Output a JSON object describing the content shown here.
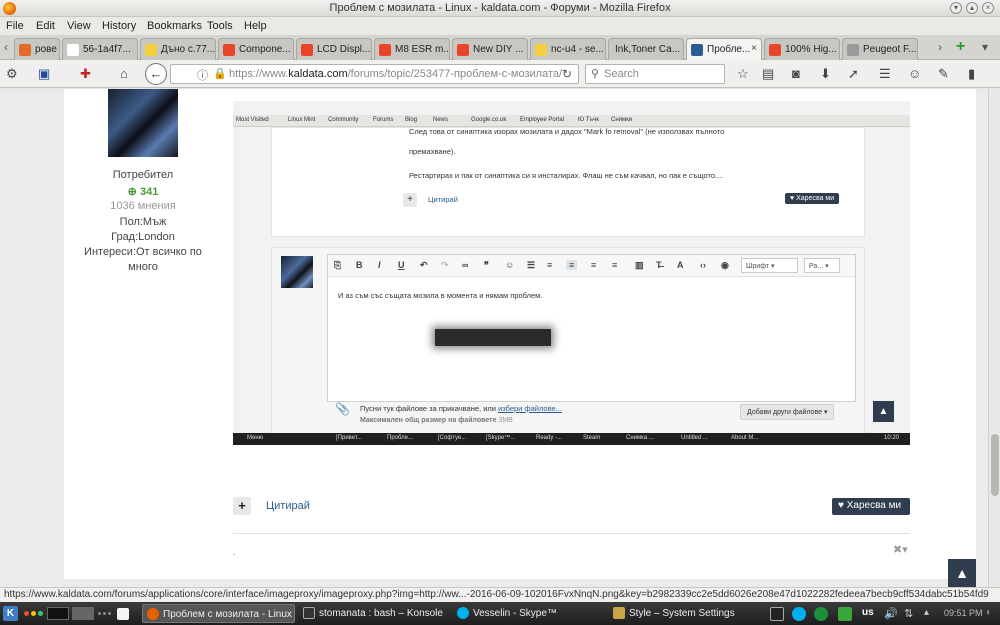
{
  "window": {
    "title": "Проблем с мозилата - Linux - kaldata.com - Форуми - Mozilla Firefox"
  },
  "menu": [
    "File",
    "Edit",
    "View",
    "History",
    "Bookmarks",
    "Tools",
    "Help"
  ],
  "tabs": [
    {
      "label": "рове и...",
      "color": "#e56b2c"
    },
    {
      "label": "56-1a4f7...",
      "color": "#ffffff"
    },
    {
      "label": "Дъно с.77...",
      "color": "#f4d03f"
    },
    {
      "label": "Compone...",
      "color": "#e8452c"
    },
    {
      "label": "LCD Displ...",
      "color": "#e8452c"
    },
    {
      "label": "M8 ESR m...",
      "color": "#e8452c"
    },
    {
      "label": "New DIY ...",
      "color": "#e8452c"
    },
    {
      "label": "nc-u4 - se...",
      "color": "#f4d03f"
    },
    {
      "label": "Ink,Toner Ca...",
      "color": "#d8d8d8"
    },
    {
      "label": "Пробле...",
      "color": "#2a5d8f",
      "active": true
    },
    {
      "label": "100% Hig...",
      "color": "#e8452c"
    },
    {
      "label": "Peugeot F...",
      "color": "#9a9a9a"
    }
  ],
  "nav": {
    "url_prefix": "https://www.",
    "url_domain": "kaldata.com",
    "url_path": "/forums/topic/253477-проблем-с-мозилата/",
    "search_placeholder": "Search"
  },
  "profile": {
    "role": "Потребител",
    "reputation": "341",
    "posts": "1036 мнения",
    "gender": "Пол:Мъж",
    "city": "Град:London",
    "interests_line1": "Интереси:От всичко по",
    "interests_line2": "много"
  },
  "shot": {
    "bookmarks": [
      "Most Visited",
      "Linux Mint",
      "Community",
      "Forums",
      "Blog",
      "News",
      "Google.co.uk",
      "Employee Portal",
      "Ю Тъчк",
      "Снимки"
    ],
    "line1": "След това от синаптика изорах мозилата и дадох \"Mark fo removal\" (не използвах пълното",
    "line2": "премахване).",
    "line3": "Рестартирах и пак от синаптика си я инсталирах. Флаш не съм качвал, но пак е същото....",
    "quote_link": "Цитирай",
    "like_label": "Харесва ми",
    "font_select": "Шрифт",
    "size_select": "Ра...",
    "editor_text": "И аз съм със същата мозила в момента и нямам проблем.",
    "attach_text": "Пусни тук файлове за прикачване, или",
    "attach_link": "избери файлове...",
    "attach_limit_label": "Максимален общ размер на файловете",
    "attach_limit_value": "3MB",
    "more_files": "Добави други файлове",
    "taskbar": [
      "Меню",
      "[Привет...",
      "Пробле...",
      "[Софтуе...",
      "[Skype™...",
      "Ready -...",
      "Steam",
      "Снимка ...",
      "Untitled ...",
      "About M..."
    ],
    "clock": "10:20"
  },
  "post_footer": {
    "quote_label": "Цитирай",
    "like_label": "Харесва ми",
    "dot": "."
  },
  "status_url": "https://www.kaldata.com/forums/applications/core/interface/imageproxy/imageproxy.php?img=http://ww...-2016-06-09-102016FvxNnqN.png&key=b2982339cc2e5dd6026e208e47d1022282fedeea7becb9cff534dabc51b54fd9",
  "taskbar": {
    "tasks": [
      {
        "label": "Проблем с мозилата - Linux ...",
        "color": "#e66000",
        "active": true
      },
      {
        "label": "stomanata : bash – Konsole",
        "color": "#333333"
      },
      {
        "label": "Vesselin - Skype™",
        "color": "#00aff0"
      },
      {
        "label": "Style – System Settings",
        "color": "#c9a64a"
      }
    ],
    "lang": "us",
    "clock": "09:51 PM"
  }
}
